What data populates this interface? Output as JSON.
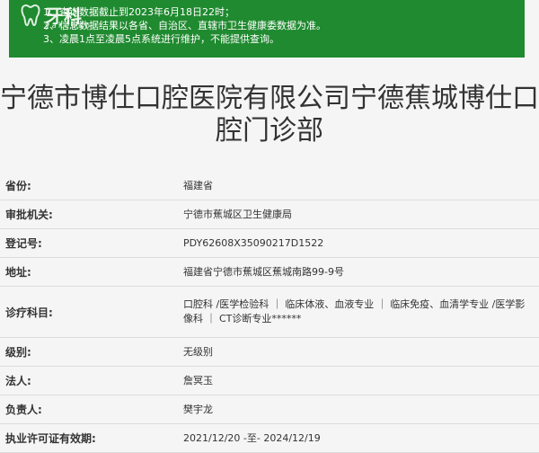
{
  "banner": {
    "lines": [
      "1、查询数据截止到2023年6月18日22时；",
      "2、信息数据结果以各省、自治区、直辖市卫生健康委数据为准。",
      "3、凌晨1点至凌晨5点系统进行维护，不能提供查询。"
    ],
    "logo_text": "牙科",
    "logo_sub": "yakebao",
    "color": "#1f8a2f"
  },
  "title": "宁德市博仕口腔医院有限公司宁德蕉城博仕口腔门诊部",
  "details": [
    {
      "label": "省份:",
      "value": "福建省"
    },
    {
      "label": "审批机关:",
      "value": "宁德市蕉城区卫生健康局"
    },
    {
      "label": "登记号:",
      "value": "PDY62608X35090217D1522"
    },
    {
      "label": "地址:",
      "value": "福建省宁德市蕉城区蕉城南路99-9号"
    },
    {
      "label": "诊疗科目:",
      "value": "口腔科 /医学检验科 ｜ 临床体液、血液专业 ｜ 临床免疫、血清学专业 /医学影像科 ｜ CT诊断专业******"
    },
    {
      "label": "级别:",
      "value": "无级别"
    },
    {
      "label": "法人:",
      "value": "詹冥玉"
    },
    {
      "label": "负责人:",
      "value": "樊宇龙"
    },
    {
      "label": "执业许可证有效期:",
      "value": "2021/12/20 -至- 2024/12/19"
    }
  ]
}
